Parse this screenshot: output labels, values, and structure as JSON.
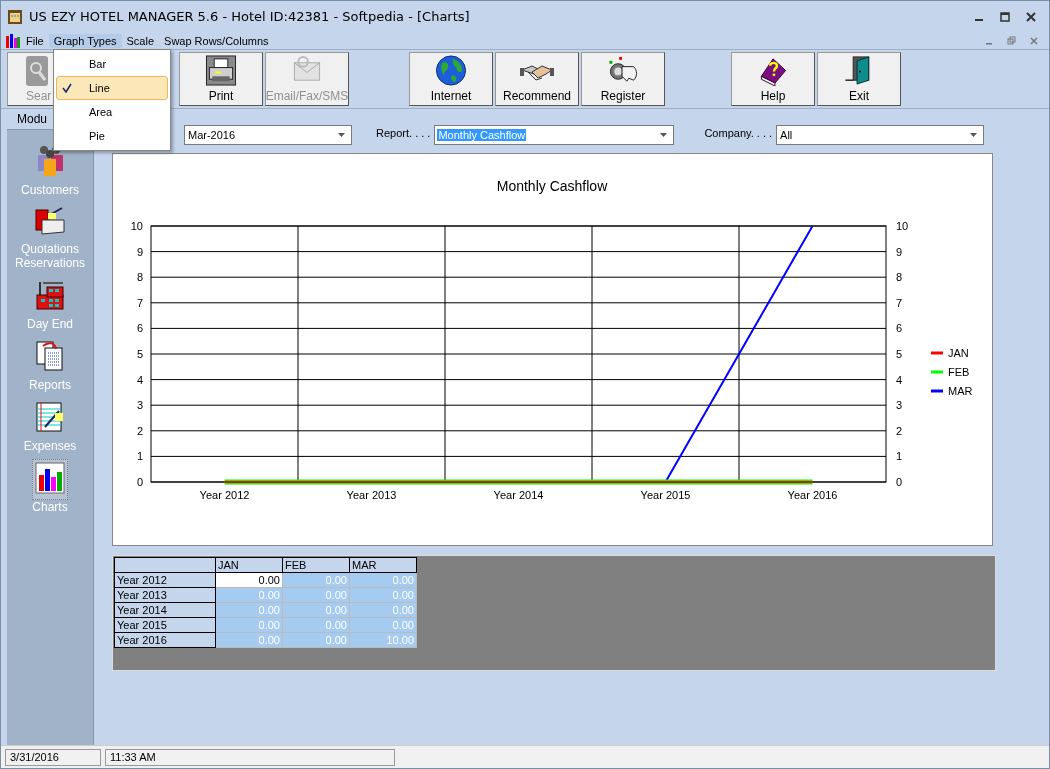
{
  "window": {
    "title": "US EZY HOTEL MANAGER 5.6 - Hotel ID:42381 - Softpedia - [Charts]"
  },
  "menu": [
    {
      "label": "File",
      "selected": false
    },
    {
      "label": "Graph Types",
      "selected": true
    },
    {
      "label": "Scale",
      "selected": false
    },
    {
      "label": "Swap Rows/Columns",
      "selected": false
    }
  ],
  "graph_types_menu": [
    {
      "label": "Bar",
      "checked": false
    },
    {
      "label": "Line",
      "checked": true
    },
    {
      "label": "Area",
      "checked": false
    },
    {
      "label": "Pie",
      "checked": false
    }
  ],
  "toolbar": [
    {
      "label": "Sear",
      "kind": "search",
      "disabled": true
    },
    {
      "label": "Print",
      "kind": "print",
      "disabled": false
    },
    {
      "label": "Email/Fax/SMS",
      "kind": "email",
      "disabled": true
    },
    {
      "label": "Internet",
      "kind": "internet",
      "disabled": false
    },
    {
      "label": "Recommend",
      "kind": "recommend",
      "disabled": false
    },
    {
      "label": "Register",
      "kind": "register",
      "disabled": false
    },
    {
      "label": "Help",
      "kind": "help",
      "disabled": false
    },
    {
      "label": "Exit",
      "kind": "exit",
      "disabled": false
    }
  ],
  "sidebar": {
    "tab": "Modu",
    "items": [
      {
        "label": "Customers",
        "kind": "customers",
        "selected": false
      },
      {
        "label": "Quotations Reservations",
        "kind": "quotations",
        "selected": false
      },
      {
        "label": "Day End",
        "kind": "dayend",
        "selected": false
      },
      {
        "label": "Reports",
        "kind": "reports",
        "selected": false
      },
      {
        "label": "Expenses",
        "kind": "expenses",
        "selected": false
      },
      {
        "label": "Charts",
        "kind": "charts",
        "selected": true
      }
    ]
  },
  "filters": [
    {
      "value": "Mar-2016",
      "value_selected": false
    },
    {
      "label": "Report. . . .",
      "value": "Monthly Cashflow",
      "value_selected": true
    },
    {
      "label": "Company. . . .",
      "value": "All",
      "value_selected": false
    }
  ],
  "chart": {
    "chart_data": {
      "type": "line",
      "title": "Monthly Cashflow",
      "categories": [
        "Year 2012",
        "Year 2013",
        "Year 2014",
        "Year 2015",
        "Year 2016"
      ],
      "ylim": [
        0,
        10
      ],
      "yticks": [
        0,
        1,
        2,
        3,
        4,
        5,
        6,
        7,
        8,
        9,
        10
      ],
      "grid": true,
      "legend": "right",
      "annotations": [
        "0",
        "1",
        "2",
        "3",
        "4",
        "5",
        "6",
        "7",
        "8",
        "9",
        "10"
      ],
      "series": [
        {
          "name": "JAN",
          "color": "#ff0000",
          "values": [
            0,
            0,
            0,
            0,
            0
          ]
        },
        {
          "name": "FEB",
          "color": "#00ff00",
          "values": [
            0,
            0,
            0,
            0,
            0
          ]
        },
        {
          "name": "MAR",
          "color": "#0000ff",
          "values": [
            null,
            null,
            null,
            0,
            10
          ]
        }
      ]
    }
  },
  "grid": {
    "columns": [
      "JAN",
      "FEB",
      "MAR"
    ],
    "rows": [
      {
        "label": "Year 2012",
        "cells": [
          {
            "text": "0.00",
            "selected": false
          },
          {
            "text": "0.00",
            "selected": true
          },
          {
            "text": "0.00",
            "selected": true
          }
        ]
      },
      {
        "label": "Year 2013",
        "cells": [
          {
            "text": "0.00",
            "selected": true
          },
          {
            "text": "0.00",
            "selected": true
          },
          {
            "text": "0.00",
            "selected": true
          }
        ]
      },
      {
        "label": "Year 2014",
        "cells": [
          {
            "text": "0.00",
            "selected": true
          },
          {
            "text": "0.00",
            "selected": true
          },
          {
            "text": "0.00",
            "selected": true
          }
        ]
      },
      {
        "label": "Year 2015",
        "cells": [
          {
            "text": "0.00",
            "selected": true
          },
          {
            "text": "0.00",
            "selected": true
          },
          {
            "text": "0.00",
            "selected": true
          }
        ]
      },
      {
        "label": "Year 2016",
        "cells": [
          {
            "text": "0.00",
            "selected": true
          },
          {
            "text": "0.00",
            "selected": true
          },
          {
            "text": "10.00",
            "selected": true
          }
        ]
      }
    ]
  },
  "status_bar": [
    "3/31/2016",
    "11:33 AM"
  ]
}
